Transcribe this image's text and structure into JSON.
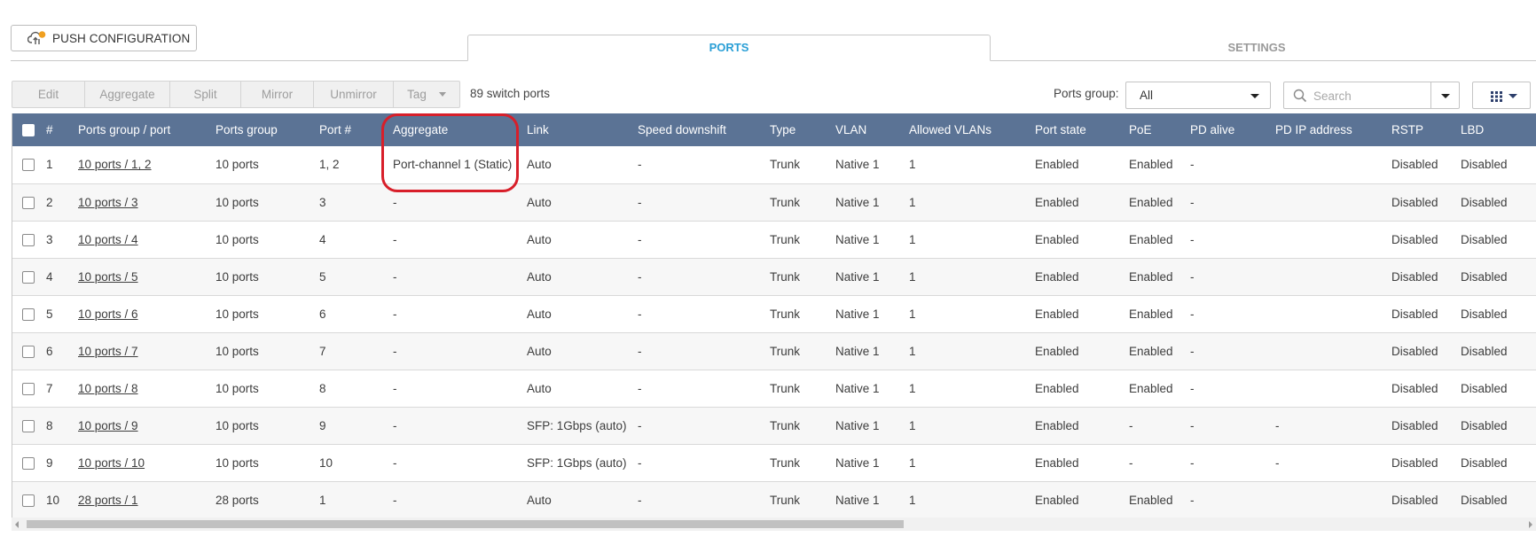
{
  "push_button": {
    "label": "PUSH CONFIGURATION",
    "icon": "cloud-upload-icon"
  },
  "tabs": [
    {
      "label": "PORTS",
      "active": true
    },
    {
      "label": "SETTINGS",
      "active": false
    }
  ],
  "toolbar": {
    "edit": "Edit",
    "aggregate": "Aggregate",
    "split": "Split",
    "mirror": "Mirror",
    "unmirror": "Unmirror",
    "tag": "Tag"
  },
  "port_count": "89 switch ports",
  "ports_group": {
    "label": "Ports group:",
    "value": "All"
  },
  "search": {
    "placeholder": "Search"
  },
  "colors": {
    "header_bg": "#5b7395",
    "accent": "#2a9fd6",
    "highlight": "#d81f2a"
  },
  "table": {
    "headers": [
      "#",
      "Ports group / port",
      "Ports group",
      "Port #",
      "Aggregate",
      "Link",
      "Speed downshift",
      "Type",
      "VLAN",
      "Allowed VLANs",
      "Port state",
      "PoE",
      "PD alive",
      "PD IP address",
      "RSTP",
      "LBD"
    ],
    "rows": [
      [
        "1",
        "10 ports / 1, 2",
        "10 ports",
        "1, 2",
        "Port-channel 1 (Static)",
        "Auto",
        "-",
        "Trunk",
        "Native 1",
        "1",
        "Enabled",
        "Enabled",
        "-",
        "",
        "Disabled",
        "Disabled"
      ],
      [
        "2",
        "10 ports / 3",
        "10 ports",
        "3",
        "-",
        "Auto",
        "-",
        "Trunk",
        "Native 1",
        "1",
        "Enabled",
        "Enabled",
        "-",
        "",
        "Disabled",
        "Disabled"
      ],
      [
        "3",
        "10 ports / 4",
        "10 ports",
        "4",
        "-",
        "Auto",
        "-",
        "Trunk",
        "Native 1",
        "1",
        "Enabled",
        "Enabled",
        "-",
        "",
        "Disabled",
        "Disabled"
      ],
      [
        "4",
        "10 ports / 5",
        "10 ports",
        "5",
        "-",
        "Auto",
        "-",
        "Trunk",
        "Native 1",
        "1",
        "Enabled",
        "Enabled",
        "-",
        "",
        "Disabled",
        "Disabled"
      ],
      [
        "5",
        "10 ports / 6",
        "10 ports",
        "6",
        "-",
        "Auto",
        "-",
        "Trunk",
        "Native 1",
        "1",
        "Enabled",
        "Enabled",
        "-",
        "",
        "Disabled",
        "Disabled"
      ],
      [
        "6",
        "10 ports / 7",
        "10 ports",
        "7",
        "-",
        "Auto",
        "-",
        "Trunk",
        "Native 1",
        "1",
        "Enabled",
        "Enabled",
        "-",
        "",
        "Disabled",
        "Disabled"
      ],
      [
        "7",
        "10 ports / 8",
        "10 ports",
        "8",
        "-",
        "Auto",
        "-",
        "Trunk",
        "Native 1",
        "1",
        "Enabled",
        "Enabled",
        "-",
        "",
        "Disabled",
        "Disabled"
      ],
      [
        "8",
        "10 ports / 9",
        "10 ports",
        "9",
        "-",
        "SFP: 1Gbps (auto)",
        "-",
        "Trunk",
        "Native 1",
        "1",
        "Enabled",
        "-",
        "-",
        "-",
        "Disabled",
        "Disabled"
      ],
      [
        "9",
        "10 ports / 10",
        "10 ports",
        "10",
        "-",
        "SFP: 1Gbps (auto)",
        "-",
        "Trunk",
        "Native 1",
        "1",
        "Enabled",
        "-",
        "-",
        "-",
        "Disabled",
        "Disabled"
      ],
      [
        "10",
        "28 ports / 1",
        "28 ports",
        "1",
        "-",
        "Auto",
        "-",
        "Trunk",
        "Native 1",
        "1",
        "Enabled",
        "Enabled",
        "-",
        "",
        "Disabled",
        "Disabled"
      ]
    ]
  }
}
